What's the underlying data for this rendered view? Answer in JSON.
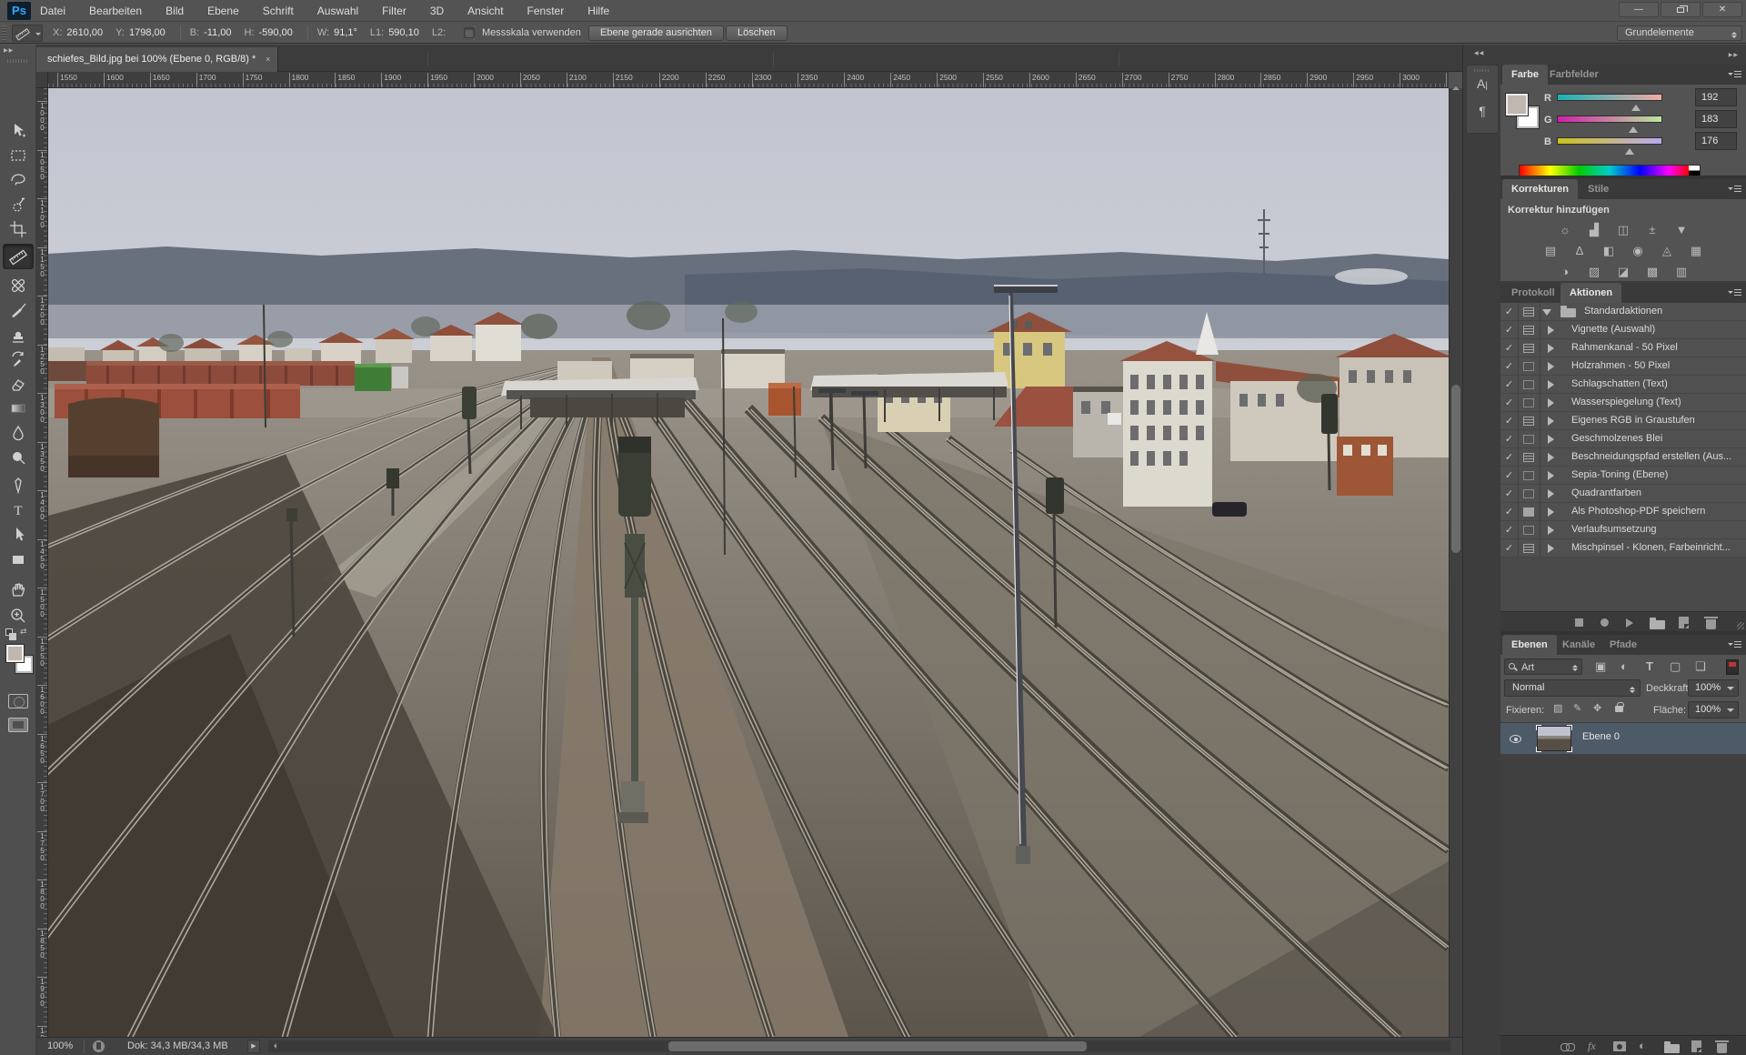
{
  "window": {
    "workspace": "Grundelemente",
    "controls": [
      "minimize",
      "restore",
      "close"
    ]
  },
  "menu": [
    "Datei",
    "Bearbeiten",
    "Bild",
    "Ebene",
    "Schrift",
    "Auswahl",
    "Filter",
    "3D",
    "Ansicht",
    "Fenster",
    "Hilfe"
  ],
  "logo": "Ps",
  "options": {
    "tool_icon": "ruler-icon",
    "fields": [
      {
        "label": "X:",
        "value": "2610,00"
      },
      {
        "label": "Y:",
        "value": "1798,00"
      },
      {
        "label": "B:",
        "value": "-11,00"
      },
      {
        "label": "H:",
        "value": "-590,00"
      },
      {
        "label": "W:",
        "value": "91,1°"
      },
      {
        "label": "L1:",
        "value": "590,10"
      },
      {
        "label": "L2:",
        "value": ""
      }
    ],
    "checkbox_label": "Messskala verwenden",
    "checkbox_checked": false,
    "straighten_button": "Ebene gerade ausrichten",
    "clear_button": "Löschen"
  },
  "document_tab": {
    "title": "schiefes_Bild.jpg bei 100% (Ebene 0, RGB/8) *",
    "close": "×"
  },
  "rulers": {
    "top_start": 1550,
    "top_end": 3050,
    "step": 50,
    "left_start": 1000,
    "left_end": 1950
  },
  "toolbar": {
    "collapse": "▶▶",
    "tools": [
      {
        "name": "move-tool"
      },
      {
        "name": "marquee-tool"
      },
      {
        "name": "lasso-tool"
      },
      {
        "name": "quick-select-tool"
      },
      {
        "name": "crop-tool"
      },
      {
        "name": "ruler-tool",
        "selected": true
      },
      {
        "name": "healing-brush-tool"
      },
      {
        "name": "brush-tool"
      },
      {
        "name": "clone-stamp-tool"
      },
      {
        "name": "history-brush-tool"
      },
      {
        "name": "eraser-tool"
      },
      {
        "name": "gradient-tool"
      },
      {
        "name": "blur-tool"
      },
      {
        "name": "dodge-tool"
      },
      {
        "name": "pen-tool"
      },
      {
        "name": "type-tool"
      },
      {
        "name": "path-select-tool"
      },
      {
        "name": "shape-tool"
      },
      {
        "name": "hand-tool"
      },
      {
        "name": "zoom-tool"
      }
    ],
    "foreground_color": "#c0b7b0",
    "background_color": "#ffffff"
  },
  "panels": {
    "color": {
      "tabs": [
        "Farbe",
        "Farbfelder"
      ],
      "active_tab": "Farbe",
      "channels": [
        {
          "label": "R",
          "value": "192",
          "pct": 0.75
        },
        {
          "label": "G",
          "value": "183",
          "pct": 0.72
        },
        {
          "label": "B",
          "value": "176",
          "pct": 0.69
        }
      ],
      "foreground": "#c0b7b0",
      "background": "#ffffff"
    },
    "adjustments": {
      "tabs": [
        "Korrekturen",
        "Stile"
      ],
      "active_tab": "Korrekturen",
      "header": "Korrektur hinzufügen",
      "rows": [
        [
          {
            "name": "brightness-contrast-icon",
            "glyph": "☼"
          },
          {
            "name": "levels-icon",
            "glyph": "▟"
          },
          {
            "name": "curves-icon",
            "glyph": "◫"
          },
          {
            "name": "exposure-icon",
            "glyph": "±"
          },
          {
            "name": "vibrance-icon",
            "glyph": "▼"
          }
        ],
        [
          {
            "name": "hue-saturation-icon",
            "glyph": "▤"
          },
          {
            "name": "color-balance-icon",
            "glyph": "Δ"
          },
          {
            "name": "black-white-icon",
            "glyph": "◧"
          },
          {
            "name": "photo-filter-icon",
            "glyph": "◉"
          },
          {
            "name": "channel-mixer-icon",
            "glyph": "◬"
          },
          {
            "name": "color-lookup-icon",
            "glyph": "▦"
          }
        ],
        [
          {
            "name": "invert-icon",
            "glyph": "◑"
          },
          {
            "name": "posterize-icon",
            "glyph": "▨"
          },
          {
            "name": "threshold-icon",
            "glyph": "◪"
          },
          {
            "name": "gradient-map-icon",
            "glyph": "▩"
          },
          {
            "name": "selective-color-icon",
            "glyph": "▥"
          }
        ]
      ]
    },
    "actions": {
      "tabs": [
        "Protokoll",
        "Aktionen"
      ],
      "active_tab": "Aktionen",
      "items": [
        {
          "label": "Standardaktionen",
          "checked": true,
          "dialog": "dialog",
          "folder": true,
          "expanded": true
        },
        {
          "label": "Vignette (Auswahl)",
          "checked": true,
          "dialog": "dialog"
        },
        {
          "label": "Rahmenkanal - 50 Pixel",
          "checked": true,
          "dialog": "dialog"
        },
        {
          "label": "Holzrahmen - 50 Pixel",
          "checked": true,
          "dialog": "empty"
        },
        {
          "label": "Schlagschatten (Text)",
          "checked": true,
          "dialog": "empty"
        },
        {
          "label": "Wasserspiegelung (Text)",
          "checked": true,
          "dialog": "empty"
        },
        {
          "label": "Eigenes RGB in Graustufen",
          "checked": true,
          "dialog": "dialog"
        },
        {
          "label": "Geschmolzenes Blei",
          "checked": true,
          "dialog": "empty"
        },
        {
          "label": "Beschneidungspfad erstellen (Aus...",
          "checked": true,
          "dialog": "dialog"
        },
        {
          "label": "Sepia-Toning (Ebene)",
          "checked": true,
          "dialog": "empty"
        },
        {
          "label": "Quadrantfarben",
          "checked": true,
          "dialog": "empty"
        },
        {
          "label": "Als Photoshop-PDF speichern",
          "checked": true,
          "dialog": "filled"
        },
        {
          "label": "Verlaufsumsetzung",
          "checked": true,
          "dialog": "empty"
        },
        {
          "label": "Mischpinsel - Klonen, Farbeinricht...",
          "checked": true,
          "dialog": "dialog"
        }
      ],
      "buttons": [
        "stop",
        "record",
        "play",
        "folder",
        "new-action",
        "delete"
      ]
    },
    "layers": {
      "tabs": [
        "Ebenen",
        "Kanäle",
        "Pfade"
      ],
      "active_tab": "Ebenen",
      "filter_value": "Art",
      "filter_icons": [
        "pixel-layer-filter-icon",
        "adjustment-layer-filter-icon",
        "type-layer-filter-icon",
        "shape-layer-filter-icon",
        "smart-object-filter-icon"
      ],
      "blend_mode": "Normal",
      "opacity_label": "Deckkraft:",
      "opacity_value": "100%",
      "lock_label": "Fixieren:",
      "fill_label": "Fläche:",
      "fill_value": "100%",
      "layer": {
        "name": "Ebene 0",
        "visible": true,
        "selected": true
      },
      "bottom_icons": [
        "link-icon",
        "fx-icon",
        "layer-mask-icon",
        "adjustment-icon",
        "group-icon",
        "new-layer-icon",
        "delete-icon"
      ]
    }
  },
  "statusbar": {
    "zoom": "100%",
    "doc_size": "Dok: 34,3 MB/34,3 MB"
  },
  "scene": {
    "description": "railway yard photo, slightly tilted, hazy sky, town and hills in background",
    "sky": "#c5c8d2",
    "hills": "#5d6573",
    "ground_light": "#959087",
    "ground_dark": "#5b554c",
    "rails": "#b7b2a8",
    "track_bed": "#413c34",
    "wagons_red": "#8d4b3b",
    "wagon_green": "#3f7d36",
    "roofs": "#96533f",
    "measure_line": "#f2f2f4"
  }
}
